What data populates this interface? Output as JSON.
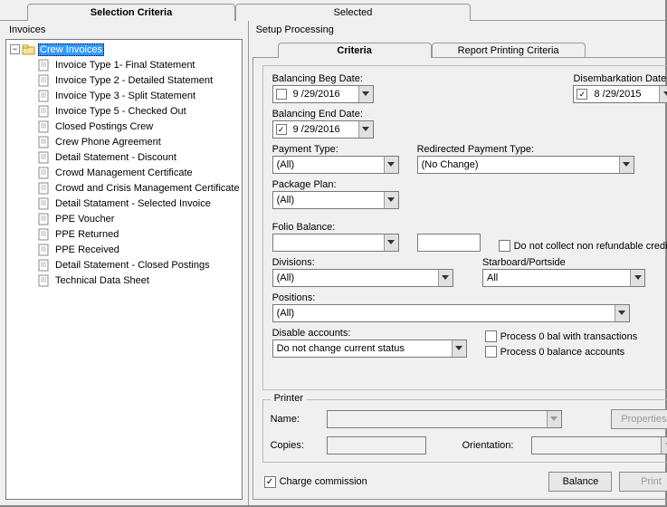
{
  "top_tabs": {
    "selection_criteria": "Selection Criteria",
    "selected": "Selected"
  },
  "left": {
    "title": "Invoices",
    "root": {
      "label": "Crew Invoices",
      "selected": true
    },
    "children": [
      "Invoice Type 1- Final Statement",
      "Invoice Type 2 - Detailed Statement",
      "Invoice Type 3 - Split Statement",
      "Invoice Type 5 - Checked Out",
      "Closed Postings Crew",
      "Crew Phone Agreement",
      "Detail Statement - Discount",
      "Crowd Management Certificate",
      "Crowd and Crisis Management Certificate",
      "Detail Statament - Selected Invoice",
      "PPE Voucher",
      "PPE Returned",
      "PPE Received",
      "Detail Statement - Closed Postings",
      "Technical Data Sheet"
    ]
  },
  "right": {
    "title": "Setup Processing",
    "tabs": {
      "criteria": "Criteria",
      "report_printing": "Report Printing Criteria"
    },
    "balancing_beg": {
      "label": "Balancing Beg Date:",
      "value": "9 /29/2016",
      "checked": false
    },
    "balancing_end": {
      "label": "Balancing End Date:",
      "value": "9 /29/2016",
      "checked": true
    },
    "disembark": {
      "label": "Disembarkation Date:",
      "value": "8 /29/2015",
      "checked": true
    },
    "payment_type": {
      "label": "Payment Type:",
      "value": "(All)"
    },
    "redirected": {
      "label": "Redirected Payment Type:",
      "value": "(No Change)"
    },
    "package_plan": {
      "label": "Package Plan:",
      "value": "(All)"
    },
    "folio_balance": {
      "label": "Folio Balance:",
      "value": ""
    },
    "folio_value": "",
    "no_refundable": {
      "label": "Do not collect non refundable credit",
      "checked": false
    },
    "divisions": {
      "label": "Divisions:",
      "value": "(All)"
    },
    "starboard": {
      "label": "Starboard/Portside",
      "value": "All"
    },
    "positions": {
      "label": "Positions:",
      "value": "(All)"
    },
    "disable_accounts": {
      "label": "Disable accounts:",
      "value": "Do not change current status"
    },
    "process0_trans": {
      "label": "Process 0 bal with transactions",
      "checked": false
    },
    "process0_bal": {
      "label": "Process 0 balance accounts",
      "checked": false
    },
    "printer": {
      "legend": "Printer",
      "name_label": "Name:",
      "name_value": "",
      "properties_btn": "Properties",
      "copies_label": "Copies:",
      "copies_value": "",
      "orientation_label": "Orientation:",
      "orientation_value": ""
    },
    "charge_commission": {
      "label": "Charge commission",
      "checked": true
    },
    "balance_btn": "Balance",
    "print_btn": "Print"
  }
}
